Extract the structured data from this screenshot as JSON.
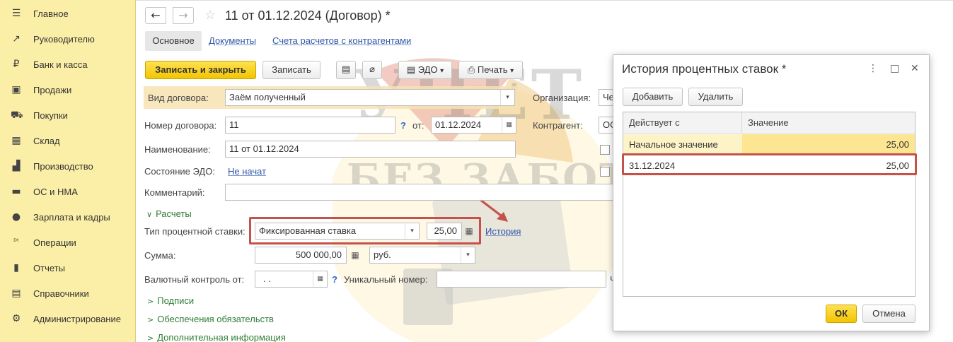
{
  "sidebar": {
    "items": [
      {
        "icon": "menu-icon",
        "glyph": "☰",
        "label": "Главное"
      },
      {
        "icon": "trend-icon",
        "glyph": "↗",
        "label": "Руководителю"
      },
      {
        "icon": "ruble-icon",
        "glyph": "₽",
        "label": "Банк и касса"
      },
      {
        "icon": "bag-icon",
        "glyph": "▣",
        "label": "Продажи"
      },
      {
        "icon": "cart-icon",
        "glyph": "⛟",
        "label": "Покупки"
      },
      {
        "icon": "warehouse-icon",
        "glyph": "▦",
        "label": "Склад"
      },
      {
        "icon": "factory-icon",
        "glyph": "▟",
        "label": "Производство"
      },
      {
        "icon": "truck-icon",
        "glyph": "▬",
        "label": "ОС и НМА"
      },
      {
        "icon": "person-icon",
        "glyph": "●",
        "label": "Зарплата и кадры"
      },
      {
        "icon": "dt-kt-icon",
        "glyph": "ᴰᵗ",
        "label": "Операции"
      },
      {
        "icon": "bar-chart-icon",
        "glyph": "▮",
        "label": "Отчеты"
      },
      {
        "icon": "book-icon",
        "glyph": "▤",
        "label": "Справочники"
      },
      {
        "icon": "gear-icon",
        "glyph": "⚙",
        "label": "Администрирование"
      }
    ]
  },
  "header": {
    "back_glyph": "←",
    "forward_glyph": "→",
    "star_glyph": "☆",
    "title": "11 от 01.12.2024 (Договор) *"
  },
  "tabs": {
    "main": "Основное",
    "documents": "Документы",
    "accounts": "Счета расчетов с контрагентами"
  },
  "toolbar": {
    "save_close": "Записать и закрыть",
    "save": "Записать",
    "list_glyph": "▤",
    "attach_glyph": "⌀",
    "edo": "ЭДО",
    "print": "Печать",
    "caret": "▾"
  },
  "form": {
    "contract_type_label": "Вид договора:",
    "contract_type_value": "Заём полученный",
    "org_label": "Организация:",
    "org_value": "Че",
    "number_label": "Номер договора:",
    "number_value": "11",
    "q": "?",
    "from_label": "от:",
    "date_value": "01.12.2024",
    "counterparty_label": "Контрагент:",
    "counterparty_value": "ОС",
    "name_label": "Наименование:",
    "name_value": "11 от 01.12.2024",
    "edo_state_label": "Состояние ЭДО:",
    "edo_state_value": "Не начат",
    "comment_label": "Комментарий:",
    "comment_value": "",
    "calculations_section": "Расчеты",
    "rate_type_label": "Тип процентной ставки:",
    "rate_type_value": "Фиксированная ставка",
    "rate_value": "25,00",
    "history_link": "История",
    "sum_label": "Сумма:",
    "sum_value": "500 000,00",
    "currency_value": "руб.",
    "currency_control_label": "Валютный контроль от:",
    "currency_control_value": ". .",
    "unique_number_label": "Уникальный номер:",
    "unique_number_value": "",
    "right_cut_letter": "Че",
    "sections": [
      "Подписи",
      "Обеспечения обязательств",
      "Дополнительная информация"
    ],
    "expanded_chevron": "∨",
    "collapsed_chevron": ">",
    "calc_glyph": "▦",
    "drop_glyph": "▾"
  },
  "watermark": {
    "line1": "УЧЕТ",
    "line2": "БЕЗ ЗАБОТ"
  },
  "dialog": {
    "title": "История процентных ставок *",
    "more_glyph": "⋮",
    "maximize_glyph": "□",
    "close_glyph": "✕",
    "add_button": "Добавить",
    "delete_button": "Удалить",
    "columns": [
      "Действует с",
      "Значение"
    ],
    "rows": [
      {
        "date": "Начальное значение",
        "value": "25,00"
      },
      {
        "date": "31.12.2024",
        "value": "25,00"
      }
    ],
    "ok_button": "ОК",
    "cancel_button": "Отмена"
  },
  "colors": {
    "sidebar_bg": "#fbeea6",
    "accent_yellow": "#f2c500",
    "link_blue": "#2f56a6",
    "section_green": "#2e7d32",
    "highlight_red": "#c5514a"
  }
}
